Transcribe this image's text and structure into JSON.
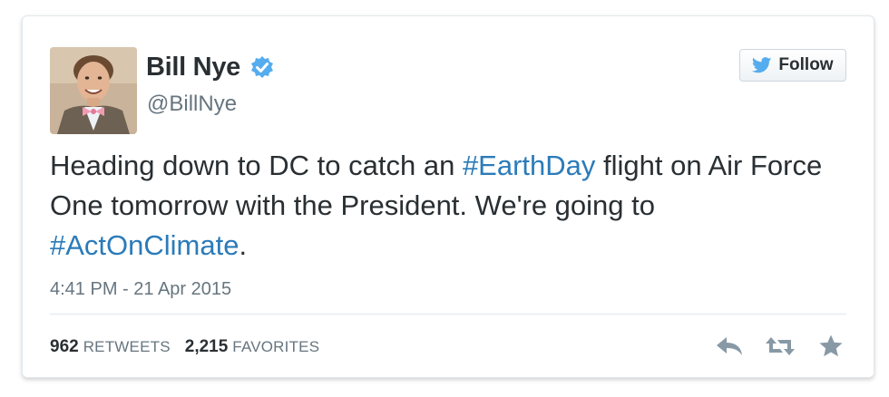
{
  "user": {
    "name": "Bill Nye",
    "handle": "@BillNye",
    "verified": true
  },
  "follow": {
    "label": "Follow",
    "icon": "twitter-bird-icon"
  },
  "tweet": {
    "segments": [
      {
        "text": "Heading down to DC to catch an ",
        "type": "text"
      },
      {
        "text": "#EarthDay",
        "type": "hashtag"
      },
      {
        "text": " flight on Air Force One tomorrow with the President. We're going to ",
        "type": "text"
      },
      {
        "text": "#ActOnClimate",
        "type": "hashtag"
      },
      {
        "text": ".",
        "type": "text"
      }
    ],
    "timestamp": "4:41 PM - 21 Apr 2015"
  },
  "stats": {
    "retweets_count": "962",
    "retweets_label": "Retweets",
    "favorites_count": "2,215",
    "favorites_label": "Favorites"
  },
  "actions": [
    "reply-icon",
    "retweet-icon",
    "favorite-star-icon"
  ],
  "colors": {
    "text": "#292f33",
    "muted": "#66757f",
    "link": "#2b7bb9",
    "verified": "#55acee",
    "icon": "#8899a6"
  }
}
